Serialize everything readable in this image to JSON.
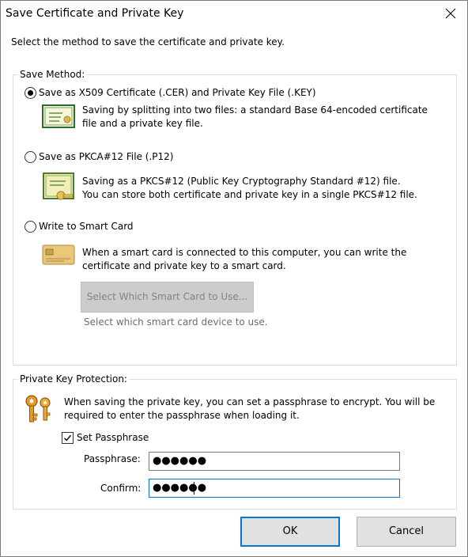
{
  "window": {
    "title": "Save Certificate and Private Key"
  },
  "instruction": "Select the method to save the certificate and private key.",
  "save_method": {
    "legend": "Save Method:",
    "options": [
      {
        "label": "Save as X509 Certificate (.CER) and Private Key File (.KEY)",
        "selected": true,
        "desc1": "Saving by splitting into two files: a standard Base 64-encoded certificate",
        "desc2": "file and a private key file.",
        "icon": "certificate-icon"
      },
      {
        "label": "Save as PKCA#12 File (.P12)",
        "selected": false,
        "desc1": "Saving as a PKCS#12 (Public Key Cryptography Standard #12) file.",
        "desc2": "You can store both certificate and private key in a single PKCS#12 file.",
        "icon": "certificate-key-file-icon"
      },
      {
        "label": "Write to Smart Card",
        "selected": false,
        "desc1": "When a smart card is connected to this computer, you can write the",
        "desc2": "certificate and private key to a smart card.",
        "icon": "smart-card-icon"
      }
    ],
    "select_card_button": "Select Which Smart Card to Use...",
    "select_card_hint": "Select which smart card device to use."
  },
  "protection": {
    "legend": "Private Key Protection:",
    "desc1": "When saving the private key, you can set a passphrase to encrypt. You will be",
    "desc2": "required to enter the passphrase when loading it.",
    "checkbox_label": "Set Passphrase",
    "checkbox_checked": true,
    "passphrase_label": "Passphrase:",
    "passphrase_value": "●●●●●●",
    "confirm_label": "Confirm:",
    "confirm_value": "●●●●●●",
    "icon": "keys-icon"
  },
  "buttons": {
    "ok": "OK",
    "cancel": "Cancel"
  },
  "colors": {
    "accent": "#0078d7",
    "group_border": "#dcdcdc",
    "disabled_button": "#cccccc"
  }
}
